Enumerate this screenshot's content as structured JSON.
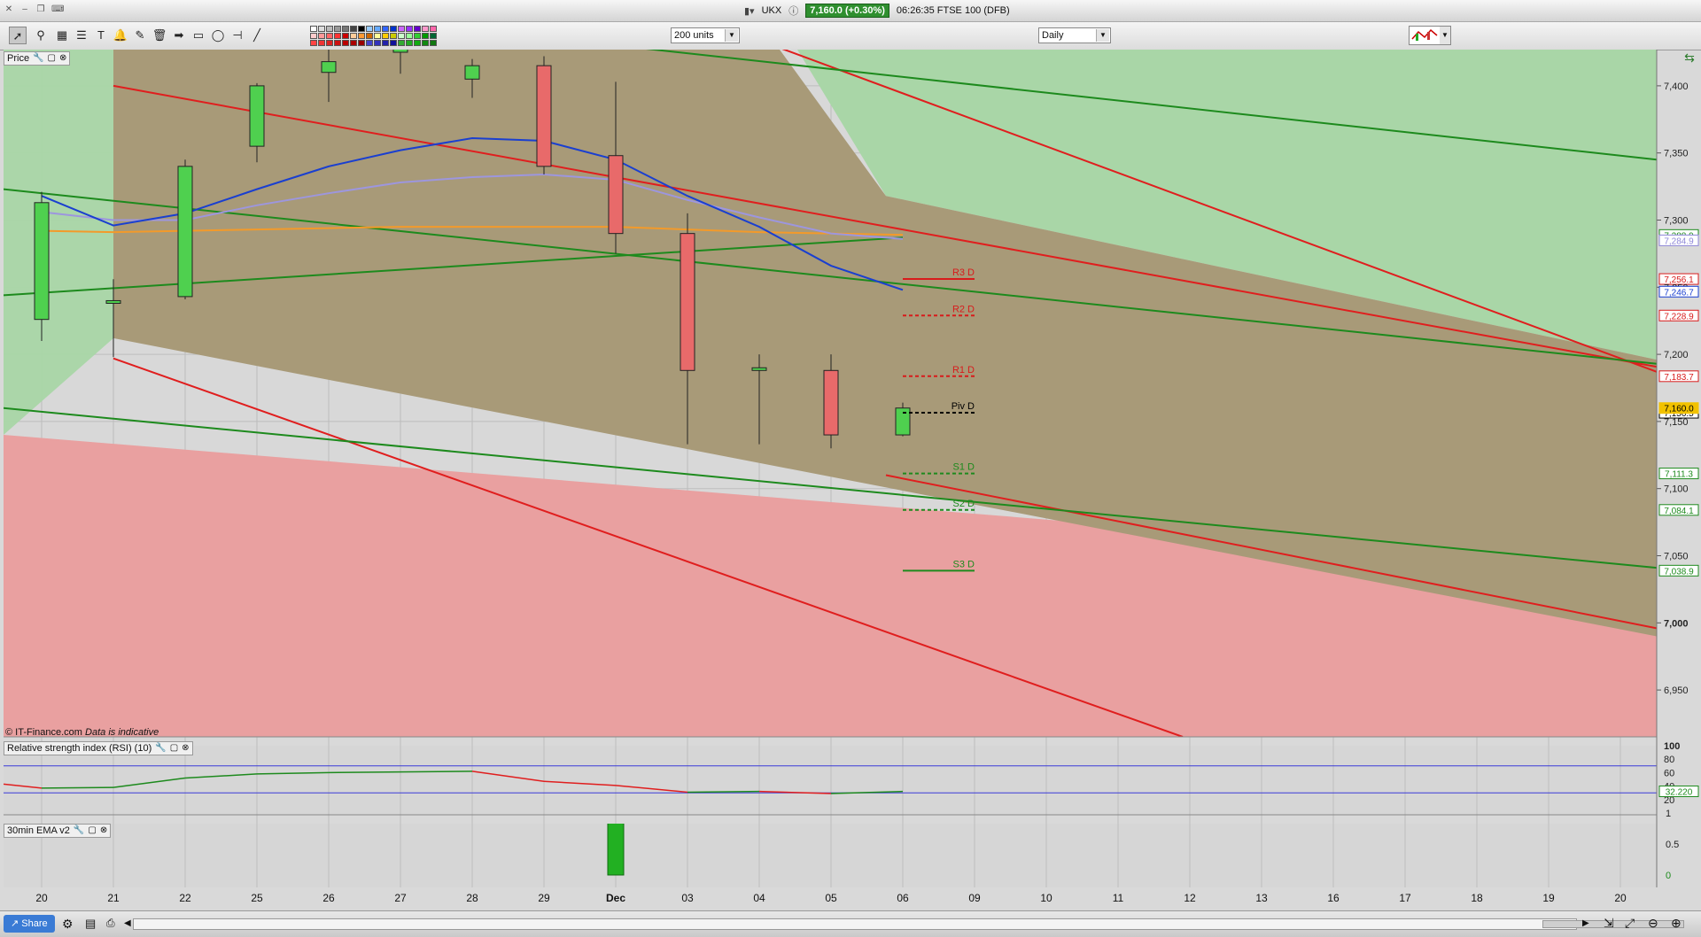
{
  "window": {
    "symbol": "UKX",
    "price_badge": "7,160.0 (+0.30%)",
    "time_text": "06:26:35 FTSE 100 (DFB)"
  },
  "toolbar": {
    "units": {
      "value": "200 units"
    },
    "interval": {
      "value": "Daily"
    },
    "tools": [
      "pointer-icon",
      "zoom-icon",
      "line-style-icon",
      "text-icon",
      "alert-bell-icon",
      "draw-tool-icon",
      "trash-icon",
      "arrow-right-icon",
      "rectangle-icon",
      "ellipse-icon",
      "horizontal-line-icon",
      "trend-line-icon"
    ]
  },
  "panels": {
    "price": {
      "label": "Price"
    },
    "rsi": {
      "label": "Relative strength index (RSI) (10)"
    },
    "ema": {
      "label": "30min EMA v2"
    }
  },
  "credit": {
    "source": "© IT-Finance.com",
    "note": "Data is indicative"
  },
  "bottombar": {
    "share_label": "Share"
  },
  "chart_data": {
    "type": "candlestick",
    "x_labels": [
      "20",
      "21",
      "22",
      "25",
      "26",
      "27",
      "28",
      "29",
      "Dec",
      "03",
      "04",
      "05",
      "06",
      "09",
      "10",
      "11",
      "12",
      "13",
      "16",
      "17",
      "18",
      "19",
      "20"
    ],
    "candles": [
      {
        "x": "20",
        "open": 7226,
        "high": 7321,
        "low": 7210,
        "close": 7313
      },
      {
        "x": "21",
        "open": 7238,
        "high": 7256,
        "low": 7198,
        "close": 7240
      },
      {
        "x": "22",
        "open": 7243,
        "high": 7345,
        "low": 7241,
        "close": 7340
      },
      {
        "x": "25",
        "open": 7355,
        "high": 7402,
        "low": 7343,
        "close": 7400
      },
      {
        "x": "26",
        "open": 7410,
        "high": 7432,
        "low": 7388,
        "close": 7418
      },
      {
        "x": "27",
        "open": 7425,
        "high": 7445,
        "low": 7409,
        "close": 7428
      },
      {
        "x": "28",
        "open": 7405,
        "high": 7420,
        "low": 7391,
        "close": 7415
      },
      {
        "x": "29",
        "open": 7415,
        "high": 7422,
        "low": 7334,
        "close": 7340
      },
      {
        "x": "Dec",
        "open": 7348,
        "high": 7403,
        "low": 7275,
        "close": 7290
      },
      {
        "x": "03",
        "open": 7290,
        "high": 7305,
        "low": 7133,
        "close": 7188
      },
      {
        "x": "04",
        "open": 7188,
        "high": 7200,
        "low": 7133,
        "close": 7190
      },
      {
        "x": "05",
        "open": 7188,
        "high": 7200,
        "low": 7130,
        "close": 7140
      },
      {
        "x": "06",
        "open": 7140,
        "high": 7164,
        "low": 7139,
        "close": 7160
      }
    ],
    "y_ticks": [
      "7,400",
      "7,350",
      "7,300",
      "7,250",
      "7,200",
      "7,150",
      "7,100",
      "7,050",
      "7,000",
      "6,950"
    ],
    "pivots": [
      {
        "name": "R3 D",
        "value": "7,256.1",
        "color": "#d81b1b"
      },
      {
        "name": "R2 D",
        "value": "7,228.9",
        "color": "#d81b1b"
      },
      {
        "name": "R1 D",
        "value": "7,183.7",
        "color": "#d81b1b"
      },
      {
        "name": "Piv D",
        "value": "7,156.5",
        "color": "#000000"
      },
      {
        "name": "S1 D",
        "value": "7,111.3",
        "color": "#1d8a1d"
      },
      {
        "name": "S2 D",
        "value": "7,084.1",
        "color": "#1d8a1d"
      },
      {
        "name": "S3 D",
        "value": "7,038.9",
        "color": "#1d8a1d"
      }
    ],
    "right_axis_tags": [
      {
        "value": "7,288.9",
        "color": "#1d8a1d"
      },
      {
        "value": "7,284.9",
        "color": "#8e86d8"
      },
      {
        "value": "7,246.7",
        "color": "#1a3fd0"
      },
      {
        "value": "7,160.0",
        "color": "#f2c200"
      }
    ],
    "ma_blue": [
      7318,
      7296,
      7305,
      7323,
      7340,
      7352,
      7361,
      7359,
      7345,
      7318,
      7295,
      7266,
      7248
    ],
    "ma_lavender": [
      7306,
      7300,
      7300,
      7311,
      7320,
      7328,
      7332,
      7334,
      7330,
      7315,
      7302,
      7290,
      7286
    ],
    "ma_orange": [
      7292,
      7291,
      7292,
      7293,
      7294,
      7295,
      7295,
      7295,
      7295,
      7293,
      7291,
      7290,
      7289
    ],
    "rsi": {
      "ticks": [
        "100",
        "80",
        "60",
        "40",
        "20"
      ],
      "current": "32.220",
      "values": [
        43,
        37,
        38,
        52,
        58,
        60,
        61,
        62,
        47,
        41,
        31,
        32,
        29,
        32
      ]
    },
    "ema": {
      "ticks": [
        "1",
        "0.5",
        "0"
      ],
      "values": [
        0,
        0,
        0,
        0,
        0,
        0,
        0,
        0,
        1,
        0,
        0,
        0,
        0
      ]
    }
  }
}
